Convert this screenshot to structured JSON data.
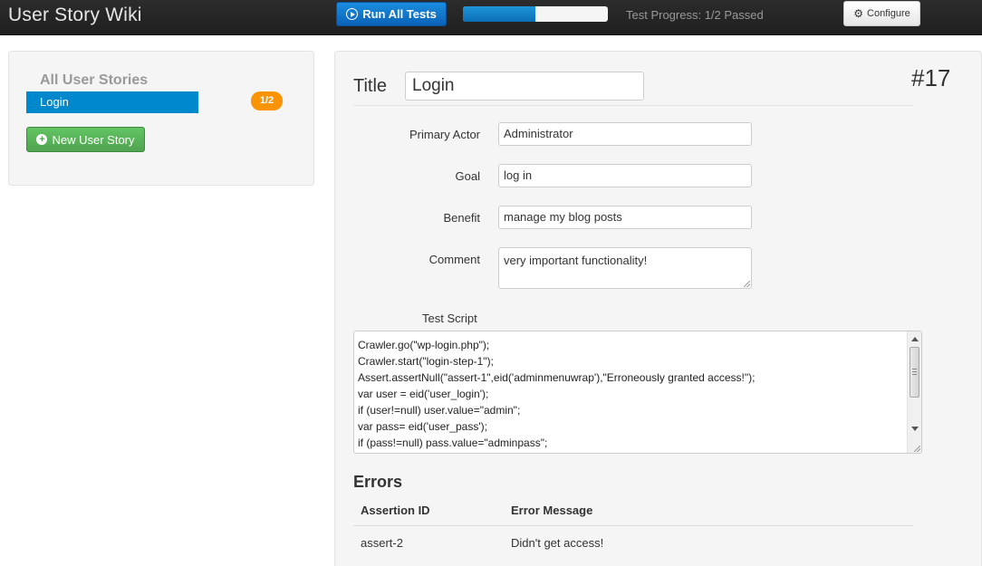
{
  "navbar": {
    "brand": "User Story Wiki",
    "run_label": "Run All Tests",
    "progress_fraction": 0.5,
    "progress_text": "Test Progress: 1/2 Passed",
    "configure_label": "Configure",
    "progress_color": "#1b8ddf"
  },
  "sidebar": {
    "header": "All User Stories",
    "items": [
      {
        "label": "Login",
        "badge": "1/2",
        "active": true
      }
    ],
    "new_story_label": "New User Story"
  },
  "story": {
    "title_label": "Title",
    "title_value": "Login",
    "number": "#17",
    "fields": {
      "primary_actor": {
        "label": "Primary Actor",
        "value": "Administrator"
      },
      "goal": {
        "label": "Goal",
        "value": "log in"
      },
      "benefit": {
        "label": "Benefit",
        "value": "manage my blog posts"
      },
      "comment": {
        "label": "Comment",
        "value": "very important functionality!"
      }
    },
    "test_script": {
      "label": "Test Script",
      "lines": [
        "Crawler.go(\"wp-login.php\");",
        "Crawler.start(\"login-step-1\");",
        "Assert.assertNull(\"assert-1\",eid('adminmenuwrap'),\"Erroneously granted access!\");",
        "var user = eid('user_login');",
        "if (user!=null) user.value=\"admin\";",
        "var pass= eid('user_pass');",
        "if (pass!=null) pass.value=\"adminpass\";"
      ]
    }
  },
  "errors": {
    "heading": "Errors",
    "columns": [
      "Assertion ID",
      "Error Message"
    ],
    "rows": [
      [
        "assert-2",
        "Didn't get access!"
      ]
    ]
  }
}
